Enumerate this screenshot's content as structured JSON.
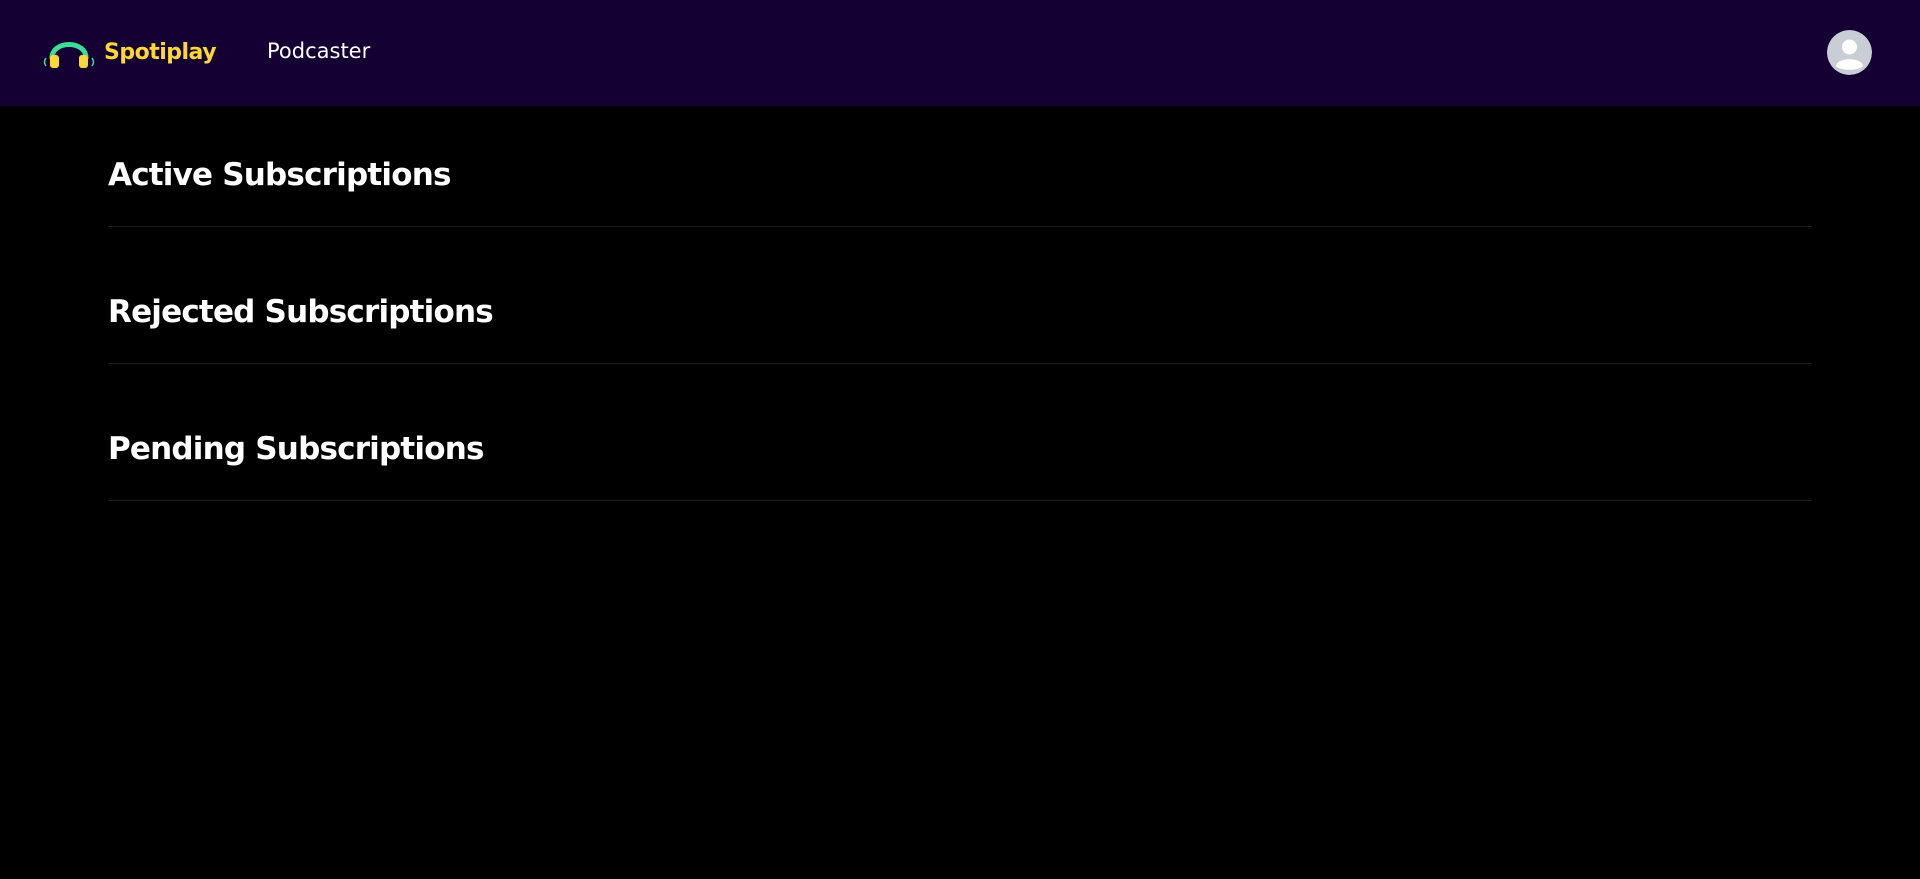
{
  "header": {
    "brand_name": "Spotiplay",
    "nav": {
      "podcaster_label": "Podcaster"
    },
    "avatar_icon": "user-avatar-icon"
  },
  "sections": [
    {
      "title": "Active Subscriptions"
    },
    {
      "title": "Rejected Subscriptions"
    },
    {
      "title": "Pending Subscriptions"
    }
  ],
  "colors": {
    "header_bg": "#140032",
    "page_bg": "#000000",
    "brand": "#FDD835",
    "logo_green": "#3DDC97",
    "text": "#FFFFFF",
    "divider": "#1F1F1F",
    "avatar_bg": "#C9CDD6"
  }
}
